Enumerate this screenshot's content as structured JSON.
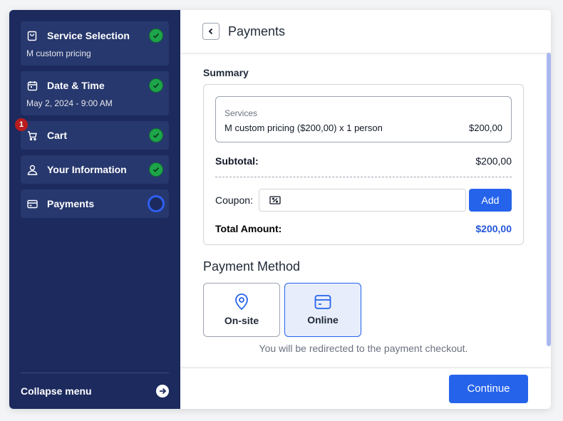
{
  "sidebar": {
    "steps": [
      {
        "title": "Service Selection",
        "subtitle": "M custom pricing",
        "icon": "shopping-bag-icon",
        "status": "complete"
      },
      {
        "title": "Date & Time",
        "subtitle": "May 2, 2024 - 9:00 AM",
        "icon": "calendar-icon",
        "status": "complete"
      },
      {
        "title": "Cart",
        "badge": "1",
        "icon": "cart-icon",
        "status": "complete"
      },
      {
        "title": "Your Information",
        "icon": "user-icon",
        "status": "complete"
      },
      {
        "title": "Payments",
        "icon": "credit-card-icon",
        "status": "in-progress"
      }
    ],
    "collapse_label": "Collapse menu"
  },
  "header": {
    "title": "Payments"
  },
  "summary": {
    "title": "Summary",
    "services_label": "Services",
    "service_item": "M custom pricing ($200,00) x 1 person",
    "service_price": "$200,00",
    "subtotal_label": "Subtotal:",
    "subtotal_value": "$200,00",
    "coupon_label": "Coupon:",
    "coupon_value": "",
    "add_label": "Add",
    "total_label": "Total Amount:",
    "total_value": "$200,00"
  },
  "payment_method": {
    "title": "Payment Method",
    "options": [
      {
        "label": "On-site",
        "icon": "map-pin-icon",
        "selected": false
      },
      {
        "label": "Online",
        "icon": "credit-card-icon",
        "selected": true
      }
    ],
    "redirect_note": "You will be redirected to the payment checkout."
  },
  "footer": {
    "continue_label": "Continue"
  },
  "colors": {
    "sidebar_bg": "#1c2a5e",
    "accent": "#2563eb",
    "success": "#1ea44a",
    "badge": "#b91c1c"
  }
}
